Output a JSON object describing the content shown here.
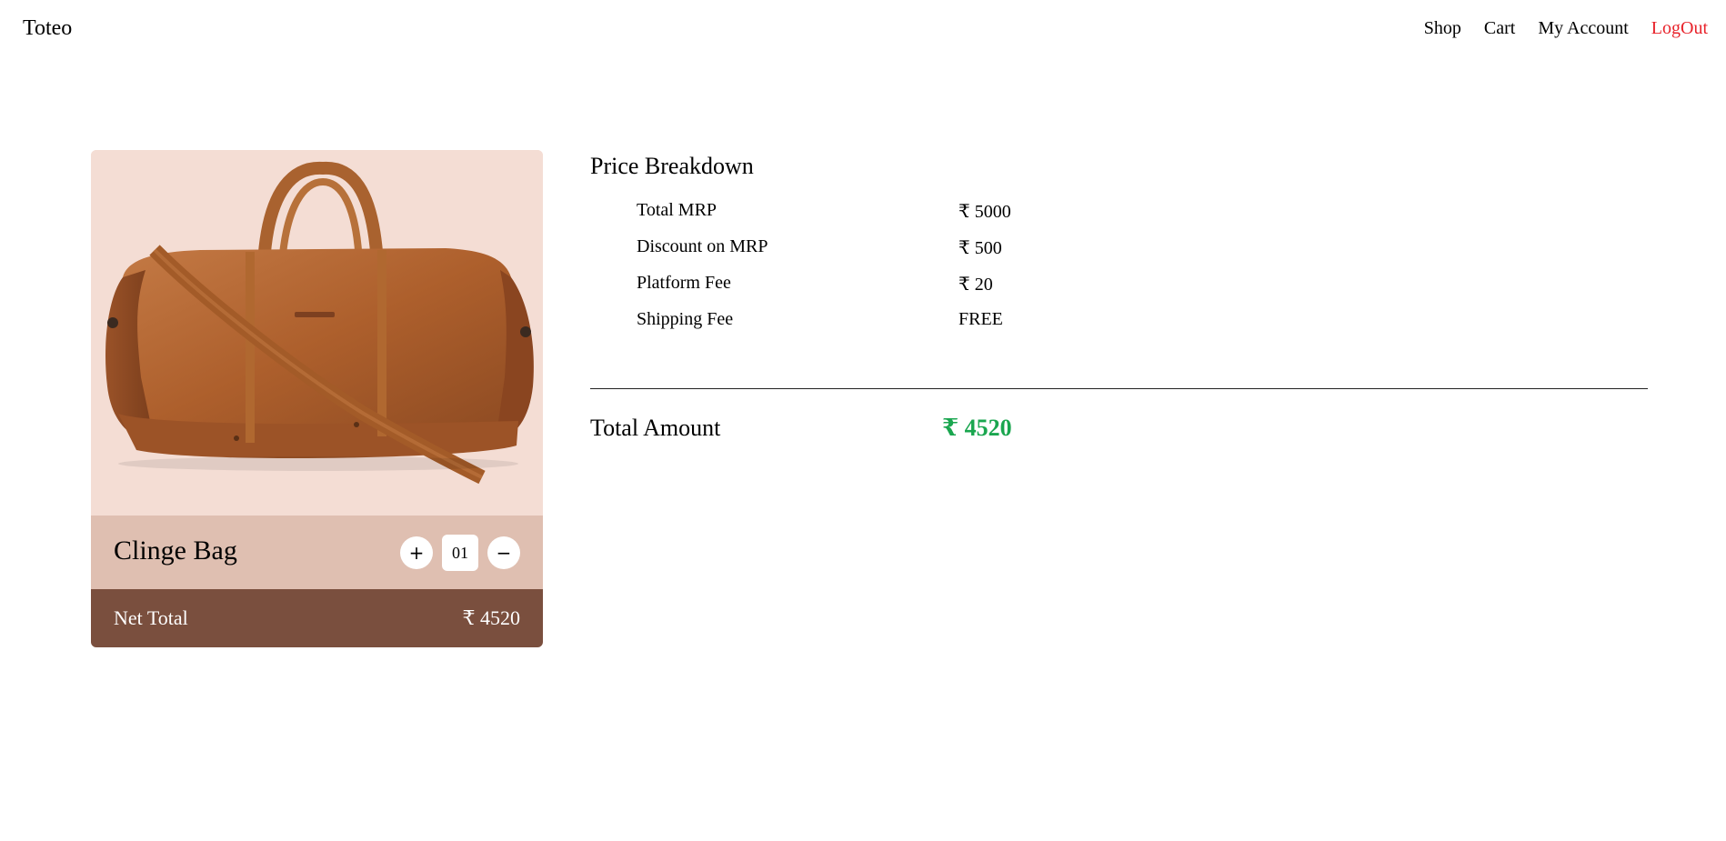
{
  "header": {
    "brand": "Toteo",
    "nav": {
      "shop": "Shop",
      "cart": "Cart",
      "account": "My Account",
      "logout": "LogOut"
    }
  },
  "product": {
    "name": "Clinge Bag",
    "quantity": "01",
    "plus": "+",
    "minus": "−",
    "net_total_label": "Net Total",
    "net_total_value": "₹ 4520",
    "image": "brown-leather-duffel-bag"
  },
  "breakdown": {
    "title": "Price Breakdown",
    "rows": [
      {
        "label": "Total MRP",
        "value": "₹ 5000"
      },
      {
        "label": "Discount on MRP",
        "value": "₹ 500"
      },
      {
        "label": "Platform Fee",
        "value": "₹ 20"
      },
      {
        "label": "Shipping Fee",
        "value": "FREE"
      }
    ],
    "total_label": "Total Amount",
    "total_value": "₹ 4520"
  },
  "colors": {
    "logout": "#e8222a",
    "total_amount": "#1aa64f",
    "card_image_bg": "#f4ddd4",
    "card_info_bg": "#dfbfb1",
    "card_total_bg": "#7a4f3e"
  }
}
